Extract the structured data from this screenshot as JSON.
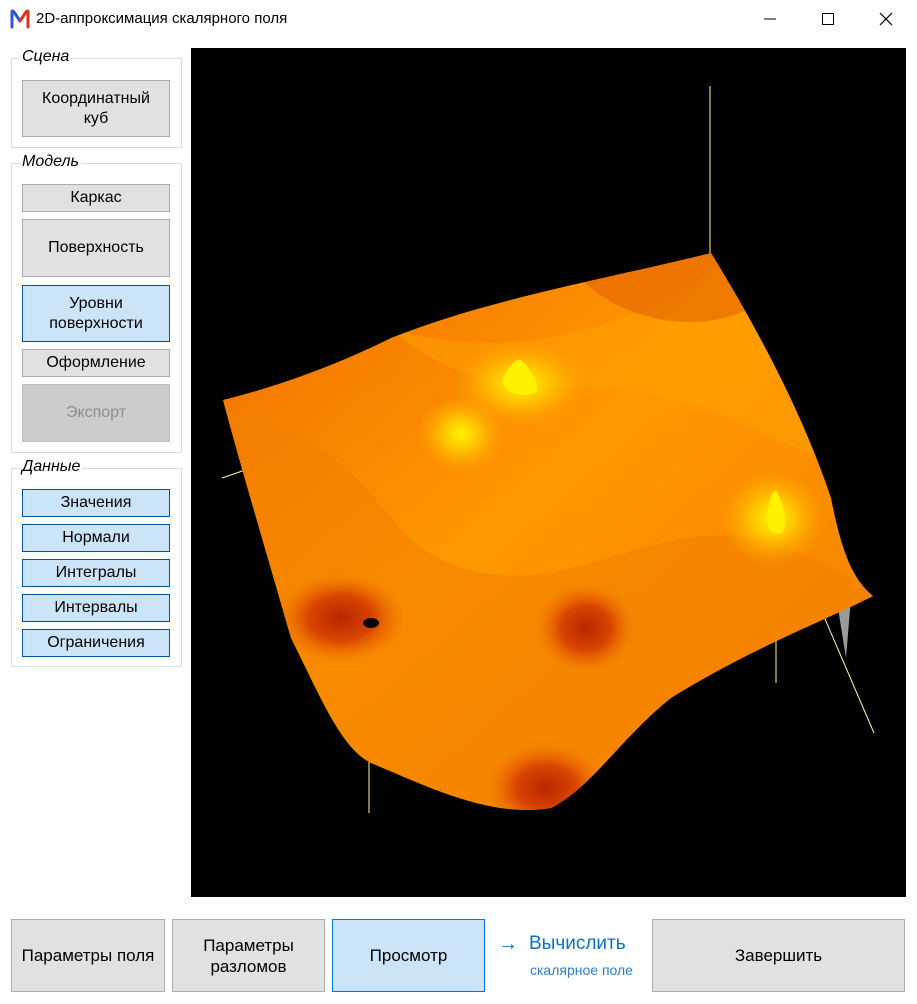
{
  "window": {
    "title": "2D-аппроксимация скалярного поля",
    "controls": [
      "minimize-icon",
      "maximize-icon",
      "close-icon"
    ]
  },
  "sidebar": {
    "scene": {
      "label": "Сцена",
      "coord_cube": "Координатный куб"
    },
    "model": {
      "label": "Модель",
      "wireframe": "Каркас",
      "surface": "Поверхность",
      "surface_levels": "Уровни поверхности",
      "styling": "Оформление",
      "export": "Экспорт"
    },
    "data": {
      "label": "Данные",
      "values": "Значения",
      "normals": "Нормали",
      "integrals": "Интегралы",
      "intervals": "Интервалы",
      "constraints": "Ограничения"
    }
  },
  "viewport": {
    "background": "#000000",
    "surface_colors": [
      "#ff7a00",
      "#ffb100",
      "#d63a00",
      "#fff200"
    ],
    "axis_color": "#fff8a0"
  },
  "bottom": {
    "field_params": "Параметры поля",
    "fault_params": "Параметры разломов",
    "preview": "Просмотр",
    "compute_main": "Вычислить",
    "compute_sub": "скалярное поле",
    "finish": "Завершить"
  },
  "colors": {
    "selected": "#cce4f7",
    "button": "#e1e1e1",
    "link": "#0a72c4"
  }
}
